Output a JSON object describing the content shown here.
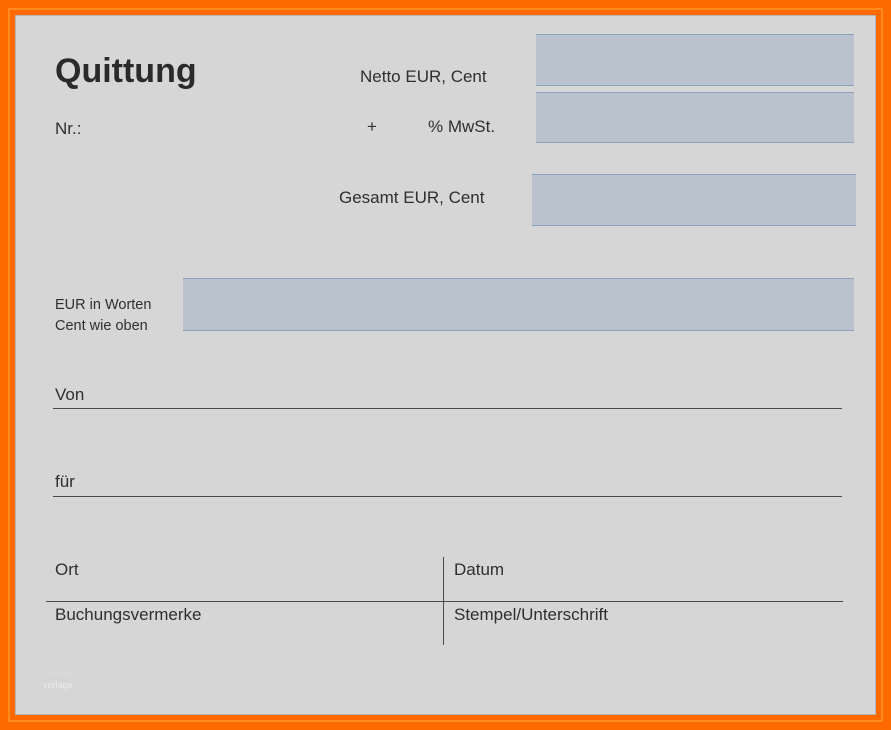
{
  "receipt": {
    "title": "Quittung",
    "nr_label": "Nr.:",
    "netto_label": "Netto EUR, Cent",
    "plus_label": "+",
    "mwst_label": "% MwSt.",
    "gesamt_label": "Gesamt EUR, Cent",
    "words_label_line1": "EUR in Worten",
    "words_label_line2": "Cent wie oben",
    "von_label": "Von",
    "fuer_label": "für",
    "ort_label": "Ort",
    "datum_label": "Datum",
    "buchung_label": "Buchungsvermerke",
    "stempel_label": "Stempel/Unterschrift",
    "fields": {
      "netto_value": "",
      "mwst_value": "",
      "gesamt_value": "",
      "words_value": ""
    }
  },
  "watermark": {
    "line1": "formular",
    "line2": "vorlage"
  }
}
